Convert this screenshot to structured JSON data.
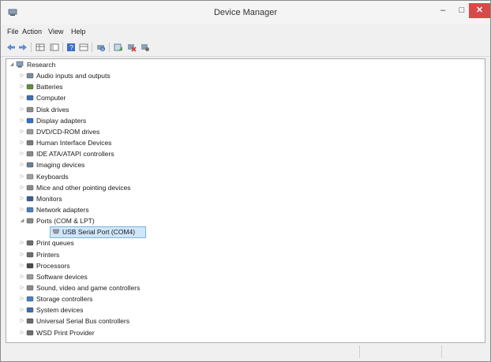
{
  "window": {
    "title": "Device Manager",
    "minimize_glyph": "–",
    "maximize_glyph": "□",
    "close_glyph": "✕"
  },
  "menu": [
    "File",
    "Action",
    "View",
    "Help"
  ],
  "toolbar_icons": [
    "back-arrow-icon",
    "forward-arrow-icon",
    "properties-grid-icon",
    "console-tree-icon",
    "help-icon",
    "view-grid-icon",
    "scan-hardware-icon",
    "update-driver-icon",
    "uninstall-device-icon",
    "disable-device-icon"
  ],
  "tree": {
    "root": "Research",
    "categories": [
      "Audio inputs and outputs",
      "Batteries",
      "Computer",
      "Disk drives",
      "Display adapters",
      "DVD/CD-ROM drives",
      "Human Interface Devices",
      "IDE ATA/ATAPI controllers",
      "Imaging devices",
      "Keyboards",
      "Mice and other pointing devices",
      "Monitors",
      "Network adapters",
      "Ports (COM & LPT)",
      "Print queues",
      "Printers",
      "Processors",
      "Software devices",
      "Sound, video and game controllers",
      "Storage controllers",
      "System devices",
      "Universal Serial Bus controllers",
      "WSD Print Provider"
    ],
    "expanded_child": "USB Serial Port (COM4)"
  },
  "colors": {
    "close_button": "#d74a4a",
    "selection": "#cfe6fb",
    "selection_border": "#7ab3e6"
  }
}
